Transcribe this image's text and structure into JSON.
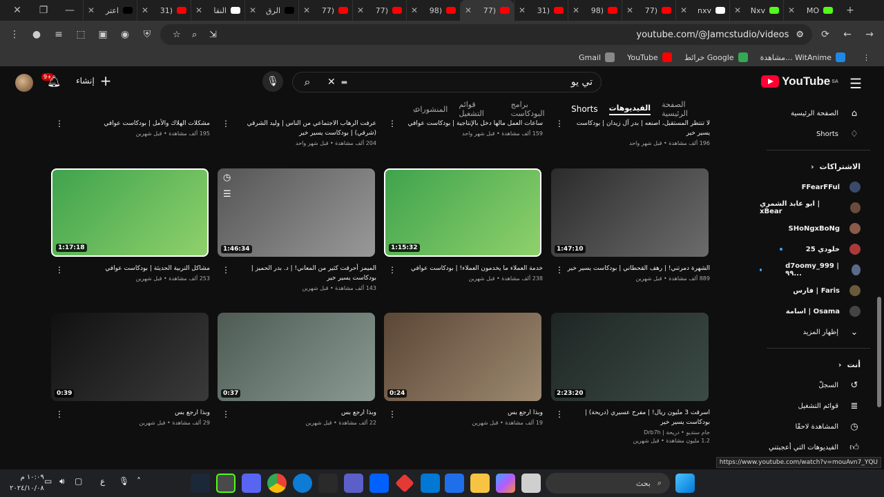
{
  "browser": {
    "tabs": [
      {
        "label": "اعتر",
        "icon": "tiktok-icon",
        "color": "#000000"
      },
      {
        "label": "(31",
        "icon": "youtube-icon",
        "color": "#ff0000"
      },
      {
        "label": "النقا",
        "icon": "notion-icon",
        "color": "#ffffff"
      },
      {
        "label": "الرق",
        "icon": "x-icon",
        "color": "#000000"
      },
      {
        "label": "(77",
        "icon": "youtube-icon",
        "color": "#ff0000"
      },
      {
        "label": "(77",
        "icon": "youtube-icon",
        "color": "#ff0000"
      },
      {
        "label": "(98",
        "icon": "youtube-icon",
        "color": "#ff0000"
      },
      {
        "label": "(77",
        "icon": "youtube-icon",
        "color": "#ff0000",
        "active": true
      },
      {
        "label": "(31",
        "icon": "youtube-icon",
        "color": "#ff0000"
      },
      {
        "label": "(98",
        "icon": "youtube-icon",
        "color": "#ff0000"
      },
      {
        "label": "(77",
        "icon": "youtube-icon",
        "color": "#ff0000"
      },
      {
        "label": "nxv",
        "icon": "notion-icon",
        "color": "#ffffff"
      },
      {
        "label": "Nxv",
        "icon": "kick-icon",
        "color": "#53fc18"
      },
      {
        "label": "MO",
        "icon": "kick-icon",
        "color": "#53fc18"
      }
    ],
    "url": "youtube.com/@Jamcstudio/videos",
    "bookmarks": [
      {
        "label": "Gmail",
        "icon": "globe-icon",
        "color": "#888888"
      },
      {
        "label": "YouTube",
        "icon": "youtube-icon",
        "color": "#ff0000"
      },
      {
        "label": "خرائط Google",
        "icon": "maps-icon",
        "color": "#34a853"
      },
      {
        "label": "مشاهدة... WitAnime",
        "icon": "witanime-icon",
        "color": "#1e88e5"
      }
    ],
    "status_url": "https://www.youtube.com/watch?v=mouAvn7_YQU"
  },
  "youtube": {
    "logo_text": "YouTube",
    "region": "SA",
    "search_query": "تي يو",
    "create_label": "إنشاء",
    "notif_count": "9+",
    "channel_tabs": [
      {
        "label": "الصفحة الرئيسية"
      },
      {
        "label": "الفيديوهات",
        "active": true
      },
      {
        "label": "Shorts"
      },
      {
        "label": "برامج البودكاست"
      },
      {
        "label": "قوائم التشغيل"
      },
      {
        "label": "المنشورات"
      }
    ]
  },
  "top_row": [
    {
      "title": "مشكلات الهلاك والأمل | بودكاست عوافي",
      "meta": "195 ألف مشاهدة • قبل شهرين"
    },
    {
      "title": "عرفت الرهاب الاجتماعي من الناس | وليد الشرقي (شرقي) | بودكاست يسير خير",
      "meta": "204 ألف مشاهدة • قبل شهر واحد"
    },
    {
      "title": "ساعات العمل مالها دخل بالإنتاجية | بودكاست عوافي",
      "meta": "159 ألف مشاهدة • قبل شهر واحد"
    },
    {
      "title": "لا تنتظر المستقبل، اصنعه | بدر آل زيدان | بودكاست يسير خير",
      "meta": "196 ألف مشاهدة • قبل شهر واحد"
    }
  ],
  "videos_row1": [
    {
      "title": "مشاكل التربية الحديثة | بودكاست عوافي",
      "meta": "253 ألف مشاهدة • قبل شهرين",
      "duration": "1:17:18"
    },
    {
      "title": "الميمز أحرقت كثير من المعاني! | د. بدر الحميز | بودكاست يسير خير",
      "meta": "143 ألف مشاهدة • قبل شهرين",
      "duration": "1:46:34"
    },
    {
      "title": "خدمة العملاء ما يخدمون العملاء! | بودكاست عوافي",
      "meta": "238 ألف مشاهدة • قبل شهرين",
      "duration": "1:15:32"
    },
    {
      "title": "الشهرة دمرتني! | رهف القحطاني | بودكاست يسير خير",
      "meta": "889 ألف مشاهدة • قبل شهرين",
      "duration": "1:47:10"
    }
  ],
  "videos_row2": [
    {
      "title": "وبذا ارجع بس",
      "meta": "29 ألف مشاهدة • قبل شهرين",
      "duration": "0:39"
    },
    {
      "title": "وبذا ارجع بس",
      "meta": "22 ألف مشاهدة • قبل شهرين",
      "duration": "0:37"
    },
    {
      "title": "وبذا ارجع بس",
      "meta": "19 ألف مشاهدة • قبل شهرين",
      "duration": "0:24"
    },
    {
      "title": "اسرقت 3 مليون ريال! | مفرح عسيري (دريحة) | بودكاست يسير خير",
      "meta": "1.2 مليون مشاهدة • قبل شهرين",
      "channel": "جام ستديو • دريحة | Drb7h",
      "duration": "2:23:20"
    }
  ],
  "sidebar": {
    "home": "الصفحة الرئيسية",
    "shorts": "Shorts",
    "subscriptions_title": "الاشتراكات",
    "subscriptions": [
      {
        "name": "FFearFFul",
        "new": false
      },
      {
        "name": "ابو عابد الشمري | xBear",
        "new": false
      },
      {
        "name": "SHoNgxBoNg",
        "new": false
      },
      {
        "name": "خلودي 25",
        "new": true
      },
      {
        "name": "d7oomy_999 | ٩٩...",
        "new": true
      },
      {
        "name": "فارس | Faris",
        "new": false
      },
      {
        "name": "اسامة | Osama",
        "new": false
      }
    ],
    "show_more": "إظهار المزيد",
    "you_title": "أنت",
    "you_items": [
      {
        "label": "السجلّ",
        "icon": "history-icon"
      },
      {
        "label": "قوائم التشغيل",
        "icon": "playlist-icon"
      },
      {
        "label": "المشاهدة لاحقًا",
        "icon": "clock-icon"
      },
      {
        "label": "الفيديوهات التي أعجبتني",
        "icon": "like-icon"
      }
    ]
  },
  "taskbar": {
    "search_label": "بحث",
    "time": "١٠:٠٩ م",
    "date": "٢٠٢٤/١٠/٠٨",
    "lang": "ع"
  }
}
